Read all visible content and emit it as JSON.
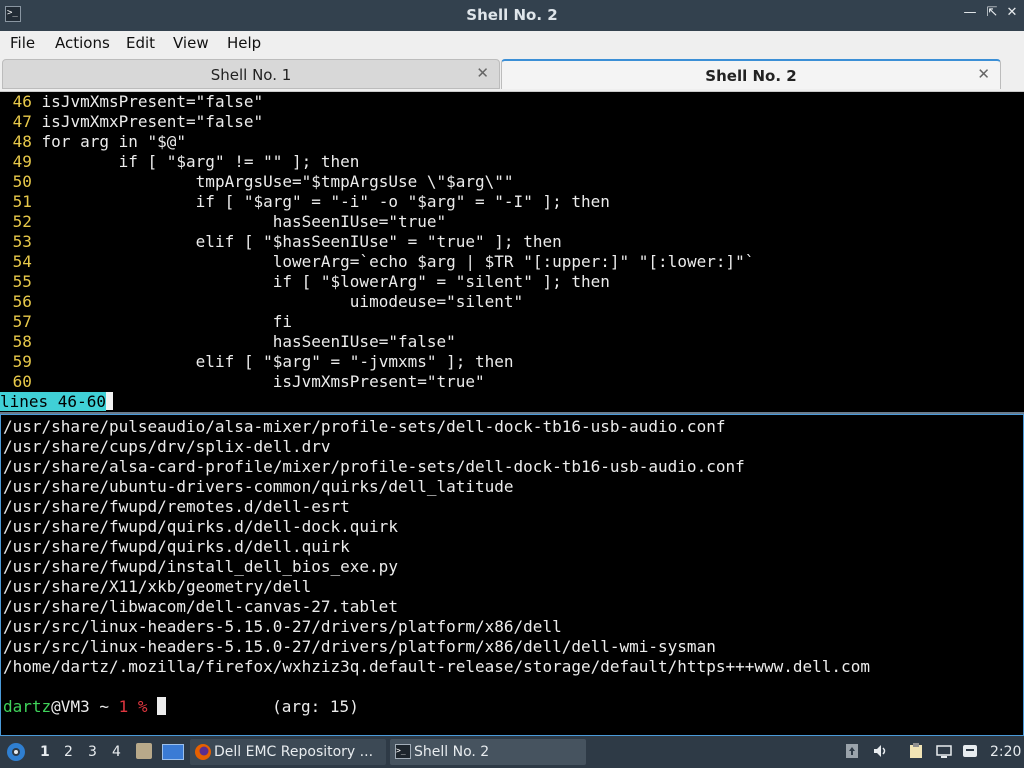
{
  "window": {
    "title": "Shell No. 2",
    "controls": [
      "minimize-icon",
      "maximize-icon",
      "close-icon"
    ]
  },
  "menu": {
    "items": [
      "File",
      "Actions",
      "Edit",
      "View",
      "Help"
    ]
  },
  "tabs": [
    {
      "label": "Shell No. 1",
      "active": false
    },
    {
      "label": "Shell No. 2",
      "active": true
    }
  ],
  "top_pane": {
    "lines": [
      {
        "num": "46",
        "text": "isJvmXmsPresent=\"false\""
      },
      {
        "num": "47",
        "text": "isJvmXmxPresent=\"false\""
      },
      {
        "num": "48",
        "text": "for arg in \"$@\""
      },
      {
        "num": "49",
        "text": "        if [ \"$arg\" != \"\" ]; then"
      },
      {
        "num": "50",
        "text": "                tmpArgsUse=\"$tmpArgsUse \\\"$arg\\\"\""
      },
      {
        "num": "51",
        "text": "                if [ \"$arg\" = \"-i\" -o \"$arg\" = \"-I\" ]; then"
      },
      {
        "num": "52",
        "text": "                        hasSeenIUse=\"true\""
      },
      {
        "num": "53",
        "text": "                elif [ \"$hasSeenIUse\" = \"true\" ]; then"
      },
      {
        "num": "54",
        "text": "                        lowerArg=`echo $arg | $TR \"[:upper:]\" \"[:lower:]\"`"
      },
      {
        "num": "55",
        "text": "                        if [ \"$lowerArg\" = \"silent\" ]; then"
      },
      {
        "num": "56",
        "text": "                                uimodeuse=\"silent\""
      },
      {
        "num": "57",
        "text": "                        fi"
      },
      {
        "num": "58",
        "text": "                        hasSeenIUse=\"false\""
      },
      {
        "num": "59",
        "text": "                elif [ \"$arg\" = \"-jvmxms\" ]; then"
      },
      {
        "num": "60",
        "text": "                        isJvmXmsPresent=\"true\""
      }
    ],
    "status": "lines 46-60"
  },
  "bottom_pane": {
    "lines": [
      "/usr/share/pulseaudio/alsa-mixer/profile-sets/dell-dock-tb16-usb-audio.conf",
      "/usr/share/cups/drv/splix-dell.drv",
      "/usr/share/alsa-card-profile/mixer/profile-sets/dell-dock-tb16-usb-audio.conf",
      "/usr/share/ubuntu-drivers-common/quirks/dell_latitude",
      "/usr/share/fwupd/remotes.d/dell-esrt",
      "/usr/share/fwupd/quirks.d/dell-dock.quirk",
      "/usr/share/fwupd/quirks.d/dell.quirk",
      "/usr/share/fwupd/install_dell_bios_exe.py",
      "/usr/share/X11/xkb/geometry/dell",
      "/usr/share/libwacom/dell-canvas-27.tablet",
      "/usr/src/linux-headers-5.15.0-27/drivers/platform/x86/dell",
      "/usr/src/linux-headers-5.15.0-27/drivers/platform/x86/dell/dell-wmi-sysman",
      "/home/dartz/.mozilla/firefox/wxhziz3q.default-release/storage/default/https+++www.dell.com"
    ],
    "prompt": {
      "user": "dartz",
      "host": "@VM3 ~ ",
      "exit_code": "1",
      "symbol": " % ",
      "arg_hint": "(arg: 15)"
    }
  },
  "taskbar": {
    "workspaces": [
      "1",
      "2",
      "3",
      "4"
    ],
    "active_workspace": "1",
    "tasks": [
      {
        "label": "Dell EMC Repository ...",
        "icon": "firefox-icon"
      },
      {
        "label": "Shell No. 2",
        "icon": "terminal-icon"
      }
    ],
    "tray_icons": [
      "updates-icon",
      "volume-icon",
      "clipboard-icon",
      "network-icon",
      "notifications-icon"
    ],
    "clock": "2:20"
  }
}
